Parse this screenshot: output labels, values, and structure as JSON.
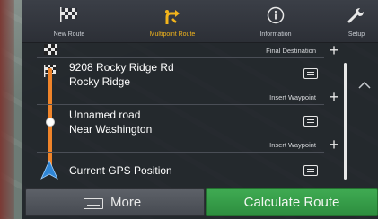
{
  "tabs": [
    {
      "label": "New Route",
      "icon": "checkered-flag-icon",
      "active": false
    },
    {
      "label": "Multipoint Route",
      "icon": "multipoint-route-icon",
      "active": true
    },
    {
      "label": "Information",
      "icon": "info-icon",
      "active": false
    },
    {
      "label": "Setup",
      "icon": "wrench-icon",
      "active": false
    }
  ],
  "route": {
    "final_destination_label": "Final Destination",
    "insert_waypoint_label": "Insert Waypoint",
    "destination": {
      "line1": "9208 Rocky Ridge Rd",
      "line2": "Rocky Ridge"
    },
    "waypoint": {
      "line1": "Unnamed road",
      "line2": "Near Washington"
    },
    "start": {
      "line1": "Current GPS Position"
    }
  },
  "buttons": {
    "more": "More",
    "calculate": "Calculate Route"
  },
  "colors": {
    "route_line": "#f0842a",
    "active_tab": "#f2b41c",
    "calculate_button": "#3faa52",
    "start_arrow": "#2f86d6"
  }
}
